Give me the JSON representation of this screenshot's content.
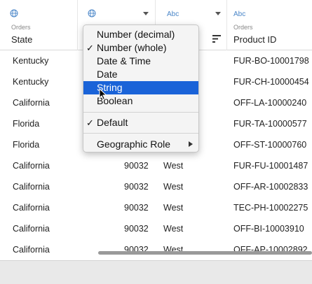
{
  "columns": [
    {
      "type_icon": "globe-icon",
      "type_label": "",
      "source": "Orders",
      "name": "State",
      "has_menu_caret": false
    },
    {
      "type_icon": "globe-icon",
      "type_label": "",
      "source": "",
      "name": "",
      "has_menu_caret": true
    },
    {
      "type_icon": "",
      "type_label": "Abc",
      "source": "",
      "name": "",
      "has_menu_caret": true
    },
    {
      "type_icon": "",
      "type_label": "Abc",
      "source": "Orders",
      "name": "Product ID",
      "has_menu_caret": false
    }
  ],
  "rows": [
    {
      "state": "Kentucky",
      "postal": "",
      "region": "",
      "product_id": "FUR-BO-10001798"
    },
    {
      "state": "Kentucky",
      "postal": "",
      "region": "",
      "product_id": "FUR-CH-10000454"
    },
    {
      "state": "California",
      "postal": "",
      "region": "",
      "product_id": "OFF-LA-10000240"
    },
    {
      "state": "Florida",
      "postal": "",
      "region": "",
      "product_id": "FUR-TA-10000577"
    },
    {
      "state": "Florida",
      "postal": "",
      "region": "",
      "product_id": "OFF-ST-10000760"
    },
    {
      "state": "California",
      "postal": "90032",
      "region": "West",
      "product_id": "FUR-FU-10001487"
    },
    {
      "state": "California",
      "postal": "90032",
      "region": "West",
      "product_id": "OFF-AR-10002833"
    },
    {
      "state": "California",
      "postal": "90032",
      "region": "West",
      "product_id": "TEC-PH-10002275"
    },
    {
      "state": "California",
      "postal": "90032",
      "region": "West",
      "product_id": "OFF-BI-10003910"
    },
    {
      "state": "California",
      "postal": "90032",
      "region": "West",
      "product_id": "OFF-AP-10002892"
    }
  ],
  "menu": {
    "items": [
      {
        "label": "Number (decimal)",
        "checked": false,
        "selected": false
      },
      {
        "label": "Number (whole)",
        "checked": true,
        "selected": false
      },
      {
        "label": "Date & Time",
        "checked": false,
        "selected": false
      },
      {
        "label": "Date",
        "checked": false,
        "selected": false
      },
      {
        "label": "String",
        "checked": false,
        "selected": true
      },
      {
        "label": "Boolean",
        "checked": false,
        "selected": false
      }
    ],
    "default_item": {
      "label": "Default",
      "checked": true
    },
    "geo_item": {
      "label": "Geographic Role",
      "has_submenu": true
    }
  },
  "colors": {
    "selection": "#1a63d8",
    "type_icon": "#4a86c8"
  }
}
